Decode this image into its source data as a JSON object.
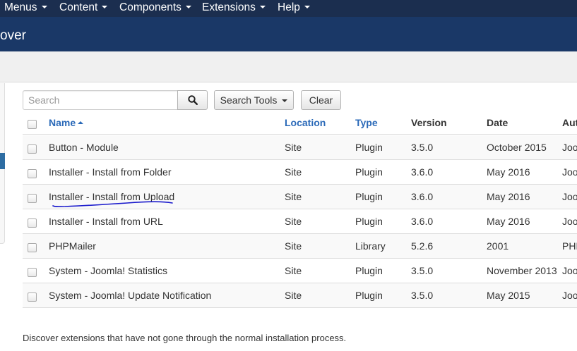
{
  "topnav": {
    "menus": [
      {
        "label": "Menus"
      },
      {
        "label": "Content"
      },
      {
        "label": "Components"
      },
      {
        "label": "Extensions"
      },
      {
        "label": "Help"
      }
    ]
  },
  "page": {
    "title": "over"
  },
  "filters": {
    "search_placeholder": "Search",
    "search_tools_label": "Search Tools",
    "clear_label": "Clear"
  },
  "table": {
    "columns": {
      "name": "Name",
      "location": "Location",
      "type": "Type",
      "version": "Version",
      "date": "Date",
      "author": "Aut"
    },
    "rows": [
      {
        "name": "Button - Module",
        "location": "Site",
        "type": "Plugin",
        "version": "3.5.0",
        "date": "October 2015",
        "author": "Joo"
      },
      {
        "name": "Installer - Install from Folder",
        "location": "Site",
        "type": "Plugin",
        "version": "3.6.0",
        "date": "May 2016",
        "author": "Joo"
      },
      {
        "name": "Installer - Install from Upload",
        "location": "Site",
        "type": "Plugin",
        "version": "3.6.0",
        "date": "May 2016",
        "author": "Joo"
      },
      {
        "name": "Installer - Install from URL",
        "location": "Site",
        "type": "Plugin",
        "version": "3.6.0",
        "date": "May 2016",
        "author": "Joo"
      },
      {
        "name": "PHPMailer",
        "location": "Site",
        "type": "Library",
        "version": "5.2.6",
        "date": "2001",
        "author": "PHP"
      },
      {
        "name": "System - Joomla! Statistics",
        "location": "Site",
        "type": "Plugin",
        "version": "3.5.0",
        "date": "November 2013",
        "author": "Joo"
      },
      {
        "name": "System - Joomla! Update Notification",
        "location": "Site",
        "type": "Plugin",
        "version": "3.5.0",
        "date": "May 2015",
        "author": "Joo"
      }
    ]
  },
  "footer": {
    "text": "Discover extensions that have not gone through the normal installation process."
  },
  "colors": {
    "topnav_bg": "#1b2e4f",
    "titlebar_bg": "#1a3867",
    "link": "#2a69b8",
    "annotation": "#1a1acc"
  }
}
